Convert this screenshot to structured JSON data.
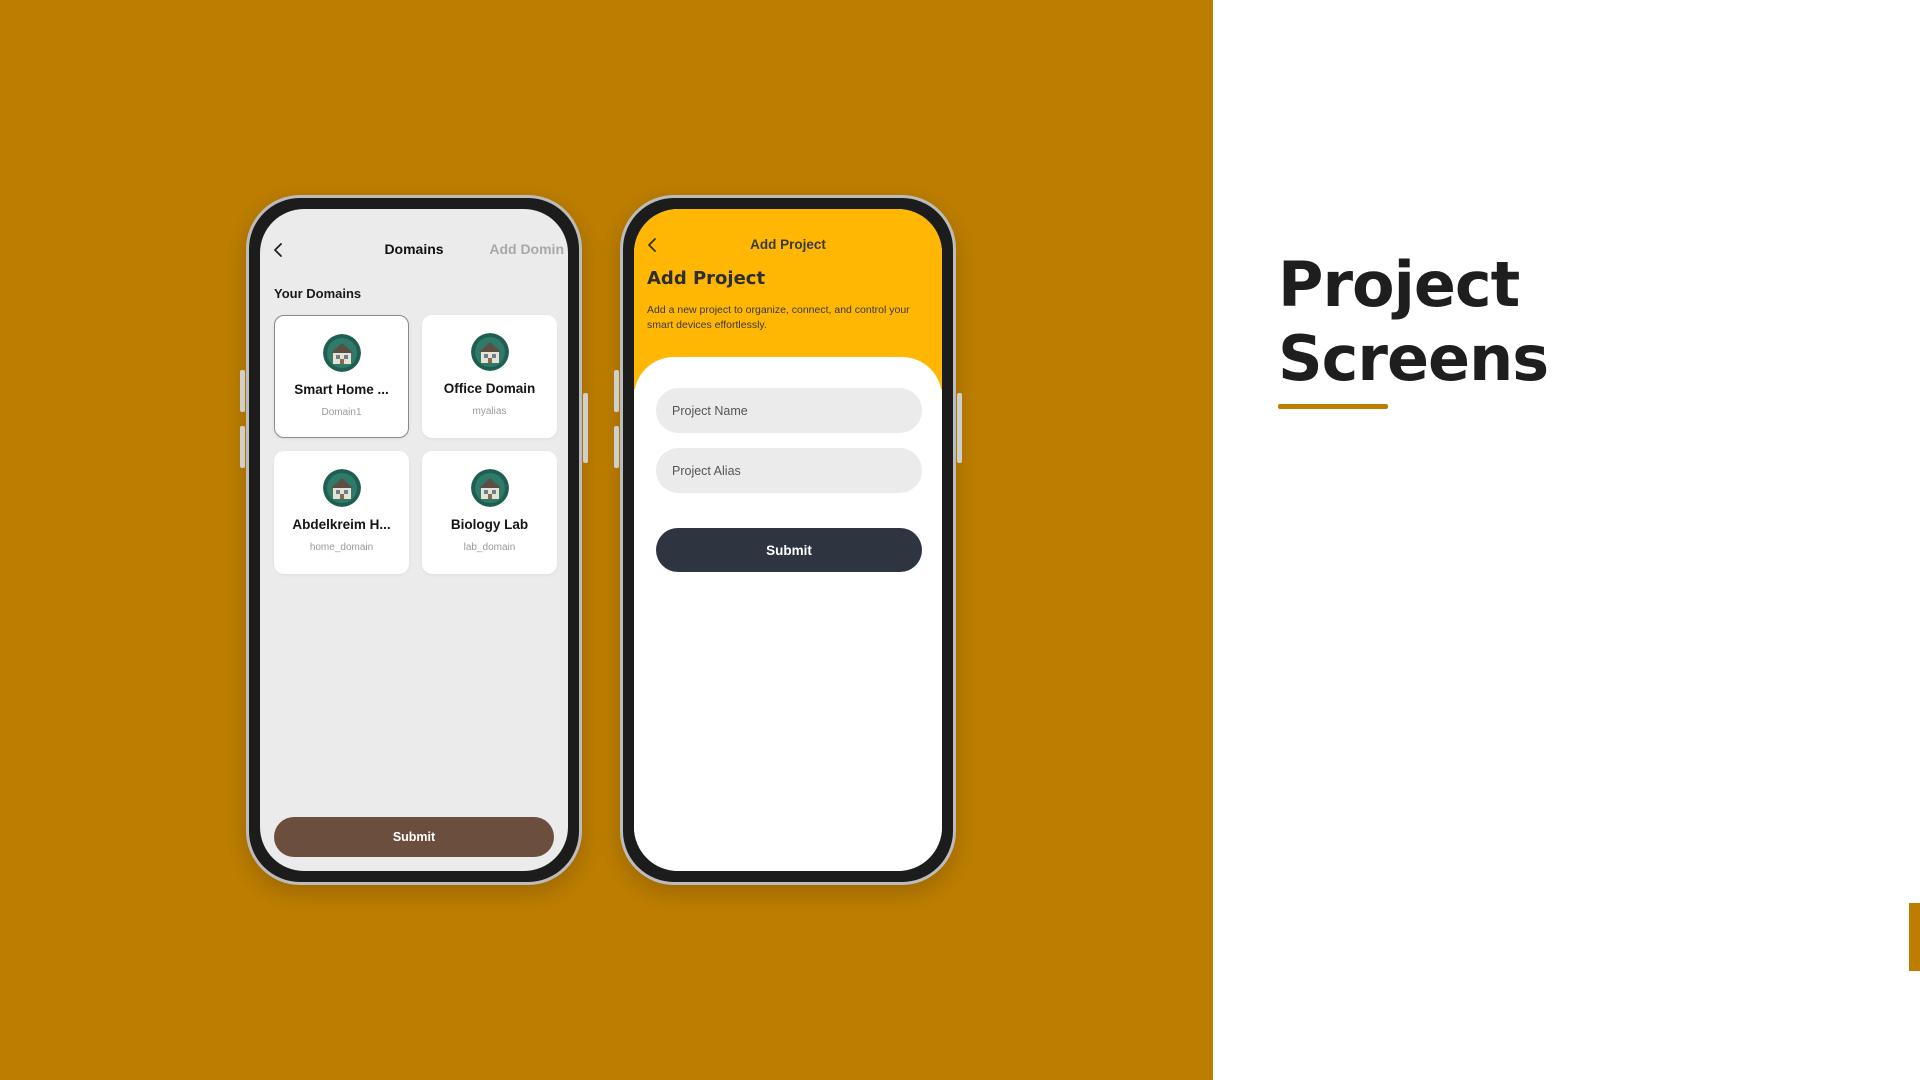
{
  "colors": {
    "brand_accent": "#bd7e00",
    "hero_yellow": "#ffb703",
    "submit_brown": "#6b4e3d",
    "submit_dark": "#2e3440",
    "screen_grey": "#ebebeb"
  },
  "slide": {
    "title_line1": "Project",
    "title_line2": "Screens"
  },
  "domains_screen": {
    "back_icon": "chevron-left-icon",
    "title": "Domains",
    "action_label": "Add Domin",
    "section_title": "Your Domains",
    "cards": [
      {
        "name": "Smart Home ...",
        "alias": "Domain1",
        "icon": "house-avatar-icon",
        "selected": true
      },
      {
        "name": "Office Domain",
        "alias": "myalias",
        "icon": "house-avatar-icon",
        "selected": false
      },
      {
        "name": "Abdelkreim H...",
        "alias": "home_domain",
        "icon": "house-avatar-icon",
        "selected": false
      },
      {
        "name": "Biology Lab",
        "alias": "lab_domain",
        "icon": "house-avatar-icon",
        "selected": false
      }
    ],
    "submit_label": "Submit"
  },
  "add_project_screen": {
    "back_icon": "chevron-left-icon",
    "nav_title": "Add Project",
    "heading": "Add Project",
    "description": "Add a new project to organize, connect, and control your smart devices effortlessly.",
    "name_placeholder": "Project Name",
    "alias_placeholder": "Project Alias",
    "submit_label": "Submit"
  }
}
